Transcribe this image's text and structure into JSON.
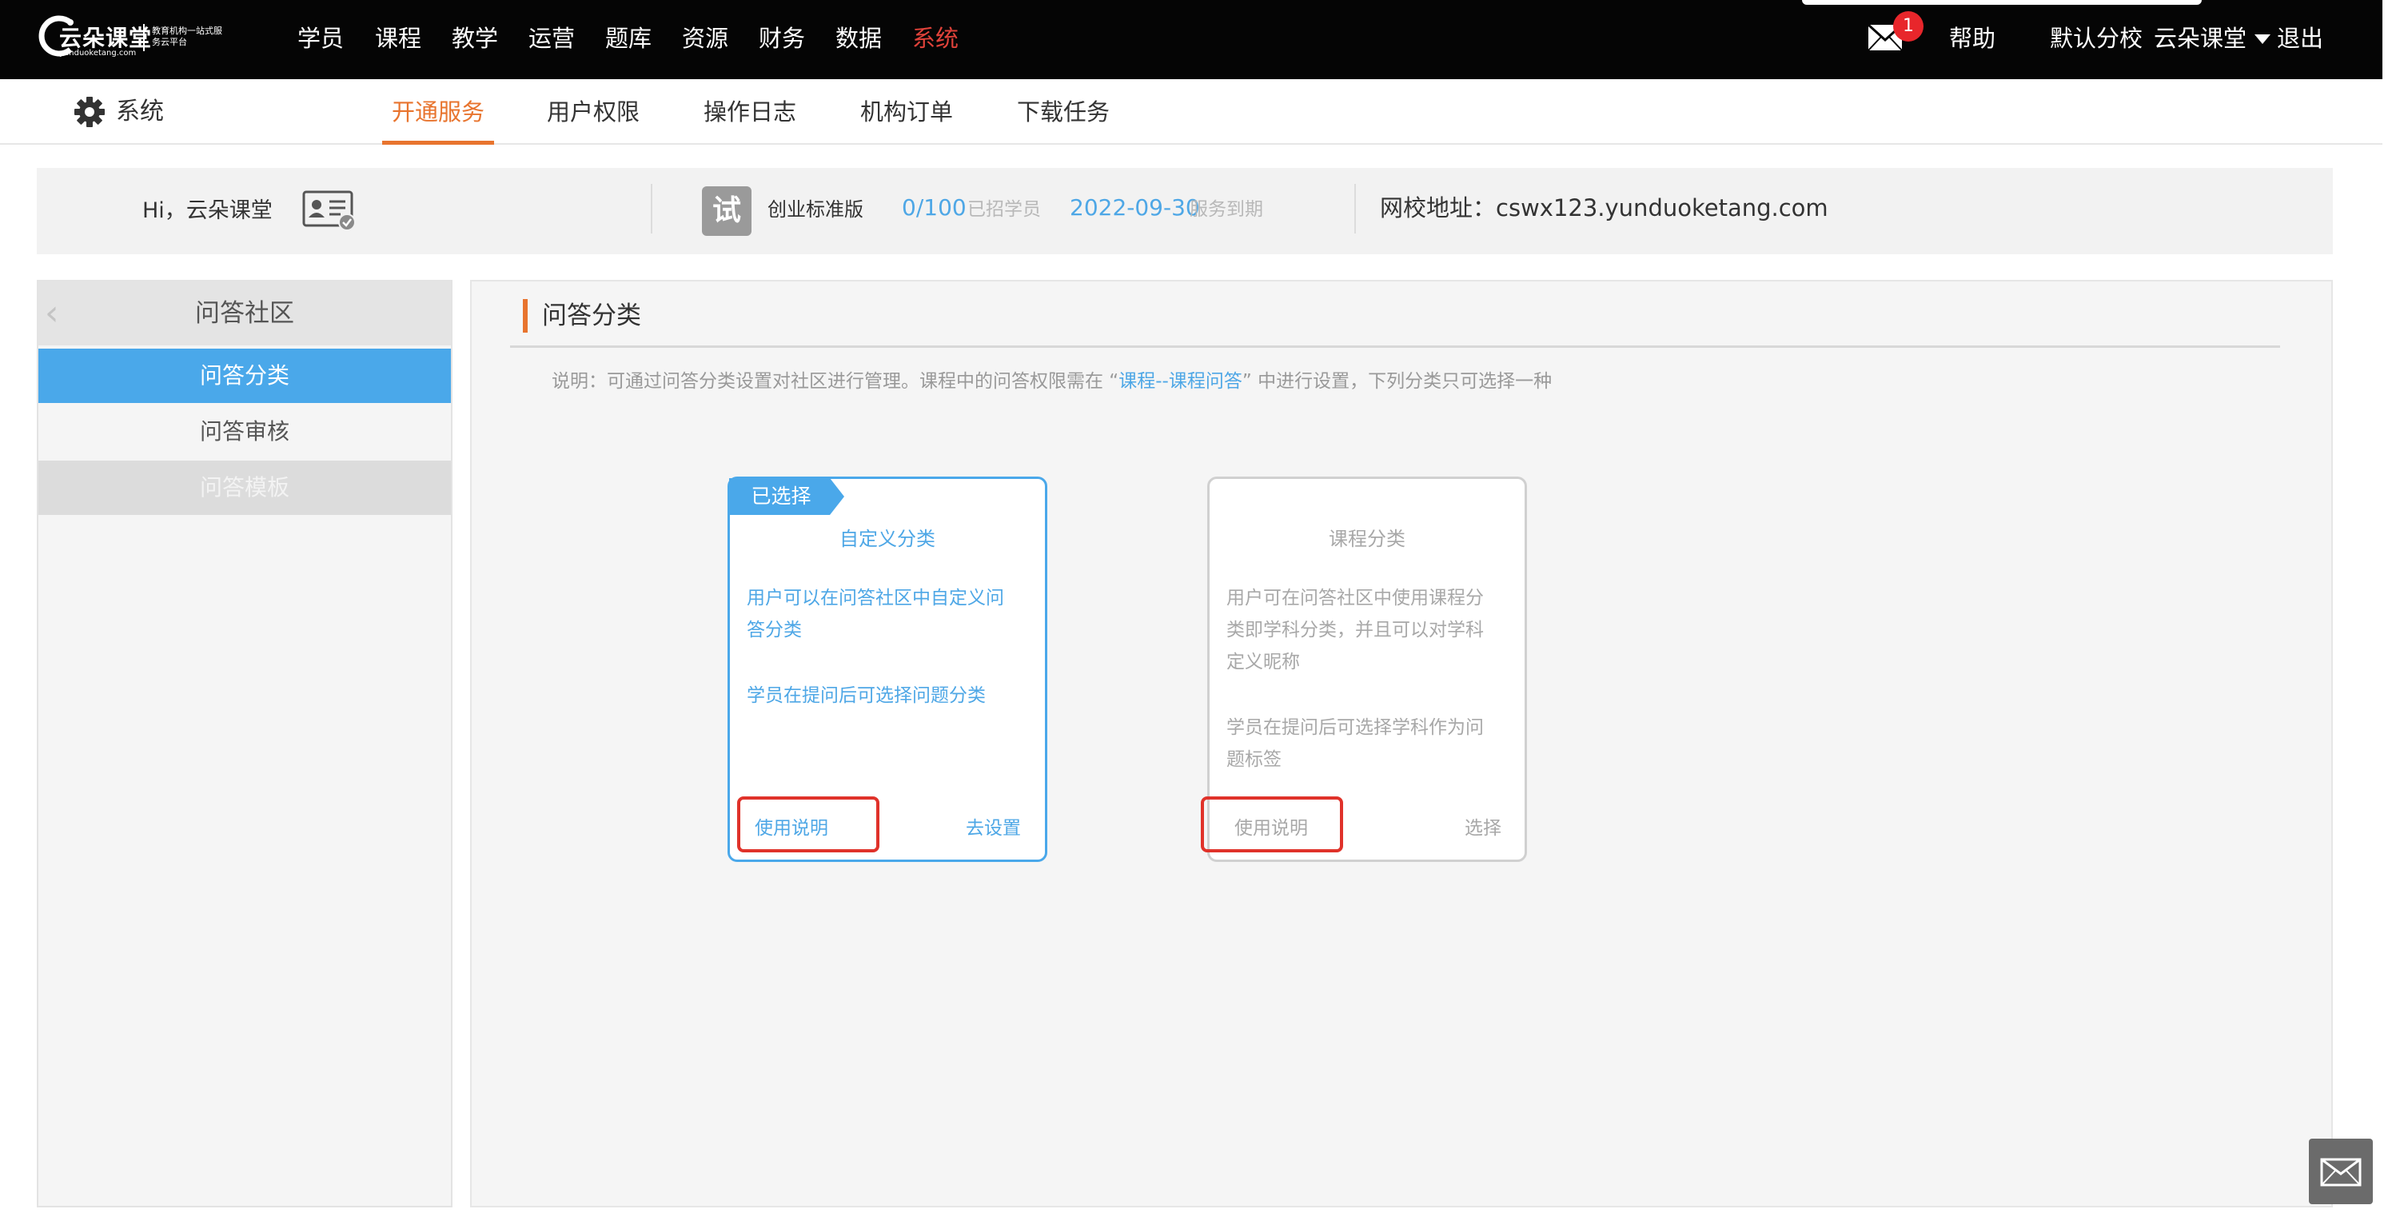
{
  "logo": {
    "brand": "云朵课堂",
    "domain": "yunduoketang.com",
    "slogan": "教育机构一站式服务云平台"
  },
  "topnav": {
    "items": [
      "学员",
      "课程",
      "教学",
      "运营",
      "题库",
      "资源",
      "财务",
      "数据",
      "系统"
    ],
    "active": "系统",
    "mail_count": "1",
    "help": "帮助",
    "branch": "默认分校",
    "user": "云朵课堂",
    "logout": "退出"
  },
  "subnav": {
    "section": "系统",
    "tabs": [
      "开通服务",
      "用户权限",
      "操作日志",
      "机构订单",
      "下载任务"
    ],
    "active_tab": "开通服务"
  },
  "info": {
    "greeting": "Hi，",
    "name": "云朵课堂",
    "trial_badge": "试",
    "plan": "创业标准版",
    "students_value": "0/100",
    "students_label": "已招学员",
    "expire_value": "2022-09-30",
    "expire_label": "服务到期",
    "school_label": "网校地址：",
    "school_url": "cswx123.yunduoketang.com"
  },
  "sidebar": {
    "title": "问答社区",
    "items": [
      {
        "label": "问答分类",
        "state": "active"
      },
      {
        "label": "问答审核",
        "state": "normal"
      },
      {
        "label": "问答模板",
        "state": "disabled"
      }
    ]
  },
  "main": {
    "title": "问答分类",
    "note_prefix": "说明：可通过问答分类设置对社区进行管理。课程中的问答权限需在 “",
    "note_link": "课程--课程问答",
    "note_suffix": "” 中进行设置，下列分类只可选择一种",
    "cards": [
      {
        "ribbon": "已选择",
        "title": "自定义分类",
        "desc1": "用户可以在问答社区中自定义问答分类",
        "desc2": "学员在提问后可选择问题分类",
        "help": "使用说明",
        "action": "去设置"
      },
      {
        "title": "课程分类",
        "desc1": "用户可在问答社区中使用课程分类即学科分类，并且可以对学科定义昵称",
        "desc2": "学员在提问后可选择学科作为问题标签",
        "help": "使用说明",
        "action": "选择"
      }
    ]
  },
  "colors": {
    "accent_blue": "#4aa8ea",
    "accent_orange": "#e8742e",
    "nav_active_red": "#e0423a",
    "highlight_red": "#e0322a"
  }
}
